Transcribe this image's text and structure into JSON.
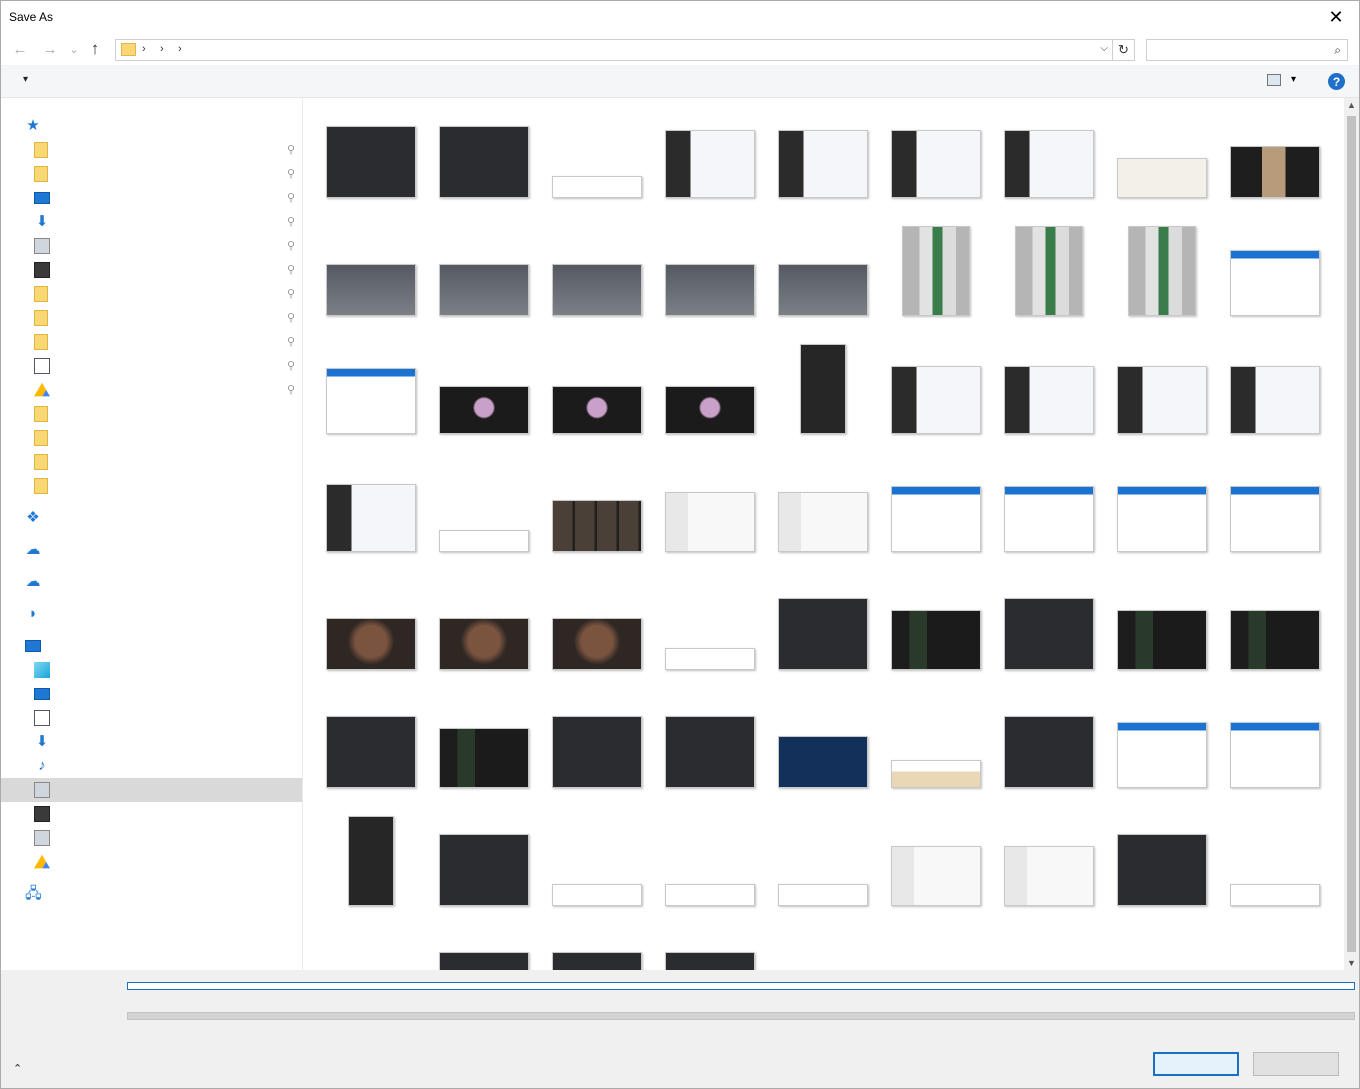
{
  "window": {
    "title": "Save As",
    "close_glyph": "✕"
  },
  "nav": {
    "back": "←",
    "forward": "→",
    "recent": "⌄",
    "up": "↑",
    "refresh": "↻",
    "addr_dropdown": "⌵",
    "chevrons": [
      "›",
      "›",
      "›"
    ]
  },
  "search": {
    "icon": "search-icon",
    "glyph": "⌕",
    "value": ""
  },
  "toolbar": {
    "organize_dropdown": "▾",
    "view_dropdown": "▾",
    "help": "?"
  },
  "navpane": {
    "pin_glyph": "📌",
    "items": [
      {
        "icon": "quick-access-star-icon",
        "type": "blue",
        "glyph": "★",
        "level": 0,
        "pinned": false
      },
      {
        "icon": "folder-icon",
        "type": "folder",
        "level": 1,
        "pinned": true
      },
      {
        "icon": "folder-icon",
        "type": "folder",
        "level": 1,
        "pinned": true
      },
      {
        "icon": "desktop-icon",
        "type": "screen",
        "level": 1,
        "pinned": true
      },
      {
        "icon": "downloads-icon",
        "type": "blue",
        "glyph": "⬇",
        "level": 1,
        "pinned": true
      },
      {
        "icon": "pictures-icon",
        "type": "gray",
        "level": 1,
        "pinned": true
      },
      {
        "icon": "videos-icon",
        "type": "film",
        "level": 1,
        "pinned": true
      },
      {
        "icon": "folder-icon",
        "type": "folder",
        "level": 1,
        "pinned": true
      },
      {
        "icon": "folder-icon",
        "type": "folder",
        "level": 1,
        "pinned": true
      },
      {
        "icon": "folder-icon",
        "type": "folder",
        "level": 1,
        "pinned": true
      },
      {
        "icon": "documents-icon",
        "type": "doc",
        "level": 1,
        "pinned": true
      },
      {
        "icon": "google-drive-icon",
        "type": "drive",
        "level": 1,
        "pinned": true
      },
      {
        "icon": "folder-icon",
        "type": "folder",
        "level": 1,
        "pinned": false
      },
      {
        "icon": "folder-icon",
        "type": "folder",
        "level": 1,
        "pinned": false
      },
      {
        "icon": "folder-icon",
        "type": "folder",
        "level": 1,
        "pinned": false
      },
      {
        "icon": "folder-icon",
        "type": "folder",
        "level": 1,
        "pinned": false
      },
      {
        "icon": "dropbox-icon",
        "type": "blue",
        "glyph": "❖",
        "level": 0,
        "pinned": false
      },
      {
        "icon": "icloud-icon",
        "type": "blue",
        "glyph": "☁",
        "level": 0,
        "pinned": false
      },
      {
        "icon": "onedrive-icon",
        "type": "blue",
        "glyph": "☁",
        "level": 0,
        "pinned": false
      },
      {
        "icon": "dropbox-replay-icon",
        "type": "blue",
        "glyph": "◗",
        "level": 0,
        "pinned": false
      },
      {
        "icon": "this-pc-icon",
        "type": "screen",
        "level": 0,
        "pinned": false
      },
      {
        "icon": "3d-objects-icon",
        "type": "box",
        "level": 1,
        "pinned": false
      },
      {
        "icon": "desktop-icon",
        "type": "screen",
        "level": 1,
        "pinned": false
      },
      {
        "icon": "documents-icon",
        "type": "doc",
        "level": 1,
        "pinned": false
      },
      {
        "icon": "downloads-icon",
        "type": "blue",
        "glyph": "⬇",
        "level": 1,
        "pinned": false
      },
      {
        "icon": "music-icon",
        "type": "blue",
        "glyph": "♪",
        "level": 1,
        "pinned": false
      },
      {
        "icon": "pictures-icon",
        "type": "gray",
        "level": 1,
        "pinned": false,
        "selected": true
      },
      {
        "icon": "videos-icon",
        "type": "film",
        "level": 1,
        "pinned": false
      },
      {
        "icon": "local-disk-icon",
        "type": "gray",
        "level": 1,
        "pinned": false
      },
      {
        "icon": "google-drive-icon",
        "type": "drive",
        "level": 1,
        "pinned": false
      },
      {
        "icon": "network-icon",
        "type": "blue",
        "glyph": "🖧",
        "level": 0,
        "pinned": false
      }
    ]
  },
  "thumbnails": {
    "rows": [
      [
        "dark",
        "dark",
        "white",
        "chat",
        "chat",
        "chat",
        "chat",
        "light",
        "person"
      ],
      [
        "people",
        "people",
        "people",
        "people",
        "people",
        "mannequin",
        "mannequin",
        "mannequin",
        "dialog"
      ],
      [
        "dialog",
        "magenta",
        "magenta",
        "magenta",
        "darktall",
        "chat",
        "chat",
        "chat",
        "chat"
      ],
      [
        "chat",
        "white",
        "video",
        "gray",
        "gray",
        "dialog",
        "dialog",
        "dialog",
        "dialog"
      ],
      [
        "face",
        "face",
        "face",
        "white",
        "dark",
        "greenterm",
        "dark",
        "greenterm",
        "greenterm"
      ],
      [
        "dark",
        "greenterm",
        "dark",
        "dark",
        "navy",
        "orange",
        "dark",
        "dialog",
        "dialog"
      ],
      [
        "darktall",
        "dark",
        "white",
        "white",
        "white",
        "gray",
        "gray",
        "dark",
        "white"
      ],
      [
        "white",
        "dark",
        "dark",
        "dark",
        "none",
        "none",
        "none",
        "none",
        "face"
      ]
    ]
  },
  "bottom": {
    "filename": "",
    "filetype": "",
    "hide_folders": "⌃",
    "save_label": "",
    "cancel_label": ""
  },
  "colors": {
    "accent": "#1a70c4",
    "selected": "#d9d9d9",
    "toolbar": "#f5f6f7"
  }
}
